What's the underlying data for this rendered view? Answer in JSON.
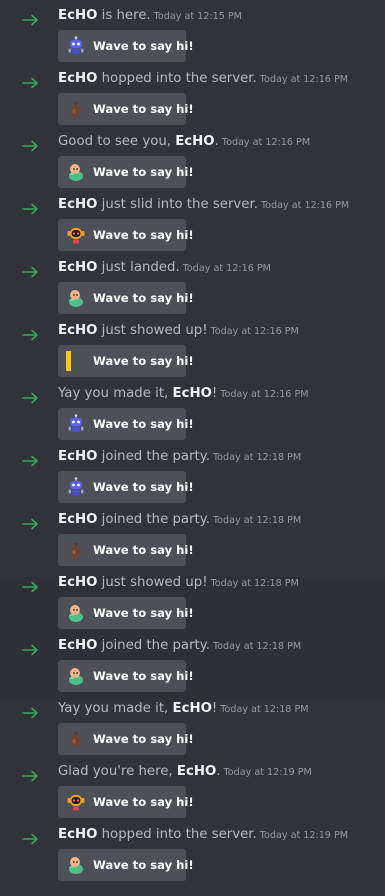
{
  "wave_label": "Wave to say hi!",
  "colors": {
    "arrow": "#3ba55c",
    "background": "#313338",
    "button": "#4e5058"
  },
  "messages": [
    {
      "pre": "",
      "name": "EcHO",
      "post": " is here.",
      "time": "Today at 12:15 PM",
      "sticker": "robot-icon"
    },
    {
      "pre": "",
      "name": "EcHO",
      "post": " hopped into the server.",
      "time": "Today at 12:16 PM",
      "sticker": "sack-icon"
    },
    {
      "pre": "Good to see you, ",
      "name": "EcHO",
      "post": ".",
      "time": "Today at 12:16 PM",
      "sticker": "wumpus-icon"
    },
    {
      "pre": "",
      "name": "EcHO",
      "post": " just slid into the server.",
      "time": "Today at 12:16 PM",
      "sticker": "clyde-bot-icon"
    },
    {
      "pre": "",
      "name": "EcHO",
      "post": " just landed.",
      "time": "Today at 12:16 PM",
      "sticker": "wumpus-icon"
    },
    {
      "pre": "",
      "name": "EcHO",
      "post": " just showed up!",
      "time": "Today at 12:16 PM",
      "sticker": "yellow-bar-icon"
    },
    {
      "pre": "Yay you made it, ",
      "name": "EcHO",
      "post": "!",
      "time": "Today at 12:16 PM",
      "sticker": "robot-icon"
    },
    {
      "pre": "",
      "name": "EcHO",
      "post": " joined the party.",
      "time": "Today at 12:18 PM",
      "sticker": "robot-icon"
    },
    {
      "pre": "",
      "name": "EcHO",
      "post": " joined the party.",
      "time": "Today at 12:18 PM",
      "sticker": "sack-icon"
    },
    {
      "pre": "",
      "name": "EcHO",
      "post": " just showed up!",
      "time": "Today at 12:18 PM",
      "sticker": "wumpus-icon"
    },
    {
      "pre": "",
      "name": "EcHO",
      "post": " joined the party.",
      "time": "Today at 12:18 PM",
      "sticker": "wumpus-icon"
    },
    {
      "pre": "Yay you made it, ",
      "name": "EcHO",
      "post": "!",
      "time": "Today at 12:18 PM",
      "sticker": "sack-icon"
    },
    {
      "pre": "Glad you're here, ",
      "name": "EcHO",
      "post": ".",
      "time": "Today at 12:19 PM",
      "sticker": "clyde-bot-icon"
    },
    {
      "pre": "",
      "name": "EcHO",
      "post": " hopped into the server.",
      "time": "Today at 12:19 PM",
      "sticker": "wumpus-icon"
    }
  ]
}
